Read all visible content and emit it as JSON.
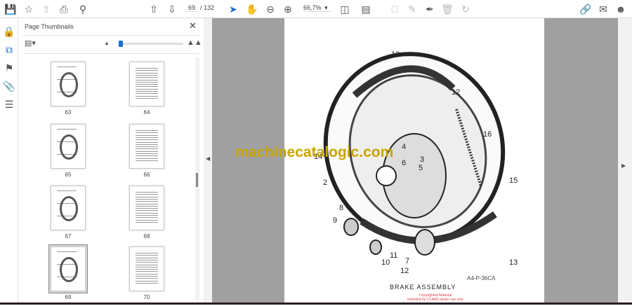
{
  "toolbar": {
    "current_page": "69",
    "total_pages": "/ 132",
    "zoom": "66,7%",
    "icons": [
      "save-icon",
      "star-icon",
      "upload-icon",
      "print-icon",
      "search-icon",
      "page-up-icon",
      "page-down-icon",
      "select-arrow-icon",
      "hand-icon",
      "zoom-out-icon",
      "zoom-in-icon",
      "page-fit-icon",
      "scroll-mode-icon",
      "comment-icon",
      "pencil-icon",
      "sign-icon",
      "delete-icon",
      "rotate-icon",
      "share-link-icon",
      "email-icon",
      "account-icon"
    ]
  },
  "rail": {
    "icons": [
      "lock-icon",
      "thumbnails-icon",
      "bookmark-icon",
      "attachment-icon",
      "layers-icon"
    ]
  },
  "panel": {
    "title": "Page Thumbnails",
    "slider_value": 0.05,
    "thumbnails": [
      {
        "label": "63"
      },
      {
        "label": "64"
      },
      {
        "label": "65"
      },
      {
        "label": "66"
      },
      {
        "label": "67"
      },
      {
        "label": "68"
      },
      {
        "label": "69"
      },
      {
        "label": "70"
      }
    ],
    "selected": "69"
  },
  "document": {
    "watermark": "machinecatalogic.com",
    "caption": "BRAKE ASSEMBLY",
    "drawing_ref": "A4-P-36CA",
    "copyright_line1": "Copyrighted Material",
    "copyright_line2": "Intended for CLAAS dealer use only",
    "callouts": [
      "13",
      "12",
      "16",
      "4",
      "3",
      "5",
      "6",
      "14",
      "2",
      "15",
      "8",
      "9",
      "11",
      "10",
      "7",
      "12",
      "13"
    ]
  }
}
